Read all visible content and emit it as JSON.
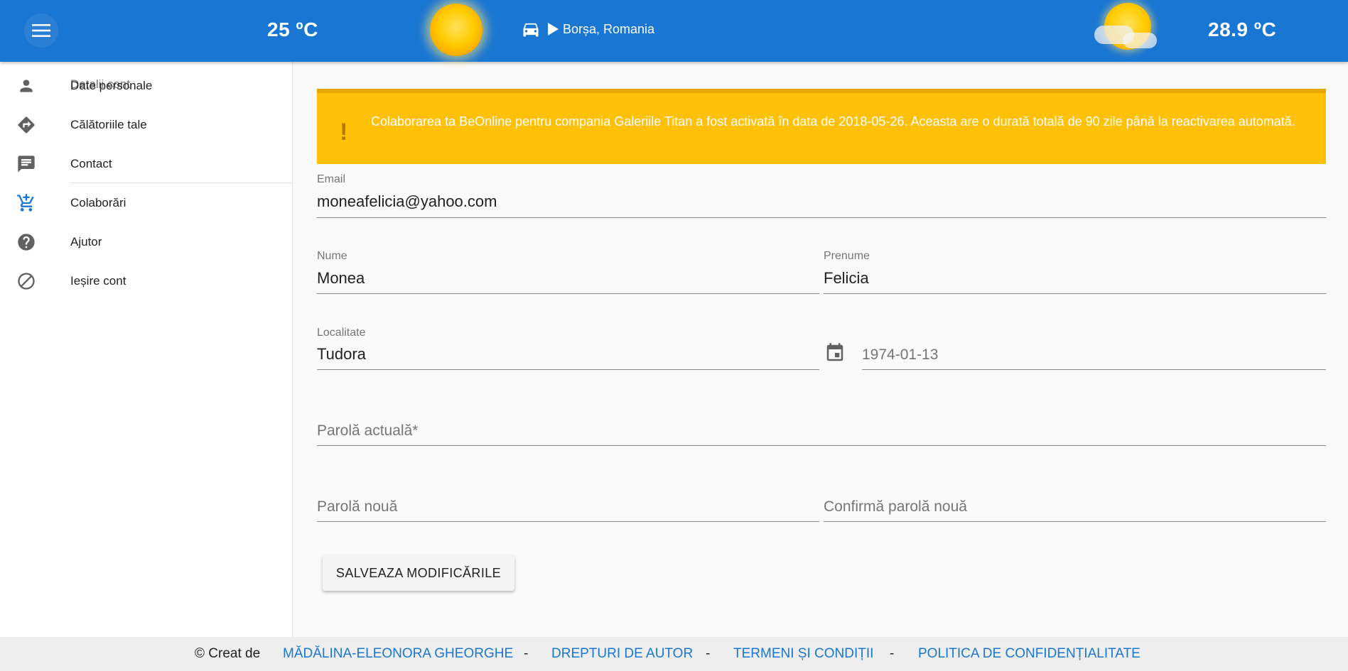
{
  "header": {
    "menu_icon": "menu-icon",
    "temp_left": "25 ºC",
    "temp_right": "28.9 ºC",
    "weather_left_icon": "sun-icon",
    "weather_right_icon": "sun-cloud-icon",
    "route_icon": "car-icon",
    "location": "Borșa, Romania",
    "accent_color": "#1976d2"
  },
  "sidebar": {
    "heading": "Detalii cont",
    "items": [
      {
        "label": "Date personale",
        "icon": "person-icon"
      },
      {
        "label": "Călătoriile tale",
        "icon": "directions-icon"
      },
      {
        "label": "Contact",
        "icon": "chat-icon"
      },
      {
        "label": "Colaborări",
        "icon": "add-cart-icon"
      },
      {
        "label": "Ajutor",
        "icon": "help-icon"
      },
      {
        "label": "Ieșire cont",
        "icon": "block-icon"
      }
    ]
  },
  "alert": {
    "icon": "!",
    "message": "Colaborarea ta BeOnline pentru compania Galeriile Titan a fost activată în data de 2018-05-26. Aceasta are o durată totală de 90 zile până la reactivarea automată.",
    "color": "#ffc107"
  },
  "form": {
    "email": {
      "label": "Email",
      "value": "moneafelicia@yahoo.com"
    },
    "nume": {
      "label": "Nume",
      "value": "Monea"
    },
    "prenume": {
      "label": "Prenume",
      "value": "Felicia"
    },
    "localitate": {
      "label": "Localitate",
      "value": "Tudora"
    },
    "birthdate": {
      "value": "1974-01-13",
      "icon": "calendar-icon"
    },
    "current_password": {
      "placeholder": "Parolă actuală*"
    },
    "new_password": {
      "placeholder": "Parolă nouă"
    },
    "confirm_password": {
      "placeholder": "Confirmă parolă nouă"
    },
    "save_label": "SALVEAZA MODIFICĂRILE"
  },
  "footer": {
    "created_by": "© Creat de",
    "author": "MĂDĂLINA-ELEONORA GHEORGHE",
    "sep": "-",
    "copyright": "DREPTURI DE AUTOR",
    "terms": "TERMENI ȘI CONDIȚII",
    "privacy": "POLITICA DE CONFIDENȚIALITATE"
  }
}
